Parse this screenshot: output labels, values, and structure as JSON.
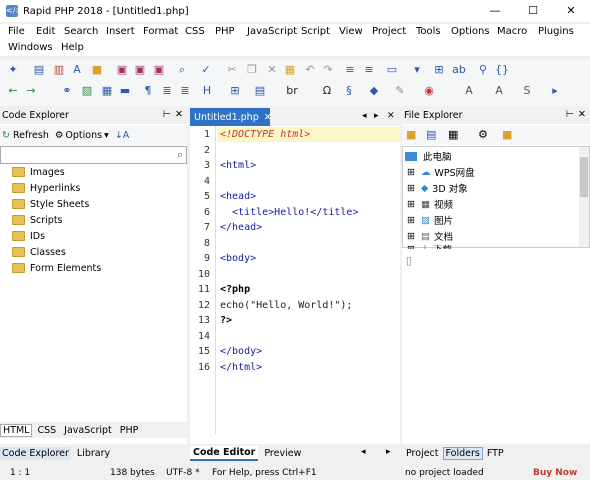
{
  "window": {
    "title": "Rapid PHP 2018 - [Untitled1.php]",
    "min": "—",
    "max": "☐",
    "close": "✕"
  },
  "menu": [
    "File",
    "Edit",
    "Search",
    "Insert",
    "Format",
    "CSS",
    "PHP",
    "JavaScript",
    "Script",
    "View",
    "Project",
    "Tools",
    "Options",
    "Macro",
    "Plugins",
    "Windows",
    "Help"
  ],
  "code_explorer": {
    "title": "Code Explorer",
    "refresh": "Refresh",
    "options": "Options",
    "items": [
      "Images",
      "Hyperlinks",
      "Style Sheets",
      "Scripts",
      "IDs",
      "Classes",
      "Form Elements"
    ],
    "lang_tabs": [
      "HTML",
      "CSS",
      "JavaScript",
      "PHP"
    ],
    "bottom_tabs": [
      "Code Explorer",
      "Library"
    ]
  },
  "editor": {
    "tab": "Untitled1.php",
    "lines": [
      {
        "n": "1",
        "text": "<!DOCTYPE html>"
      },
      {
        "n": "2",
        "text": ""
      },
      {
        "n": "3",
        "text": "<html>"
      },
      {
        "n": "4",
        "text": ""
      },
      {
        "n": "5",
        "text": "<head>"
      },
      {
        "n": "6",
        "text": "  <title>Hello!</title>"
      },
      {
        "n": "7",
        "text": "</head>"
      },
      {
        "n": "8",
        "text": ""
      },
      {
        "n": "9",
        "text": "<body>"
      },
      {
        "n": "10",
        "text": ""
      },
      {
        "n": "11",
        "text": "<?php"
      },
      {
        "n": "12",
        "text": "echo(\"Hello, World!\");"
      },
      {
        "n": "13",
        "text": "?>"
      },
      {
        "n": "14",
        "text": ""
      },
      {
        "n": "15",
        "text": "</body>"
      },
      {
        "n": "16",
        "text": "</html>"
      }
    ],
    "bottom_tabs": [
      "Code Editor",
      "Preview"
    ]
  },
  "file_explorer": {
    "title": "File Explorer",
    "root": "此电脑",
    "items": [
      "WPS网盘",
      "3D 对象",
      "视频",
      "图片",
      "文档",
      "下载"
    ],
    "bottom_tabs": [
      "Project",
      "Folders",
      "FTP"
    ]
  },
  "status": {
    "position": "1 : 1",
    "size": "138 bytes",
    "encoding": "UTF-8 *",
    "help": "For Help, press Ctrl+F1",
    "project": "no project loaded",
    "buy": "Buy Now"
  }
}
